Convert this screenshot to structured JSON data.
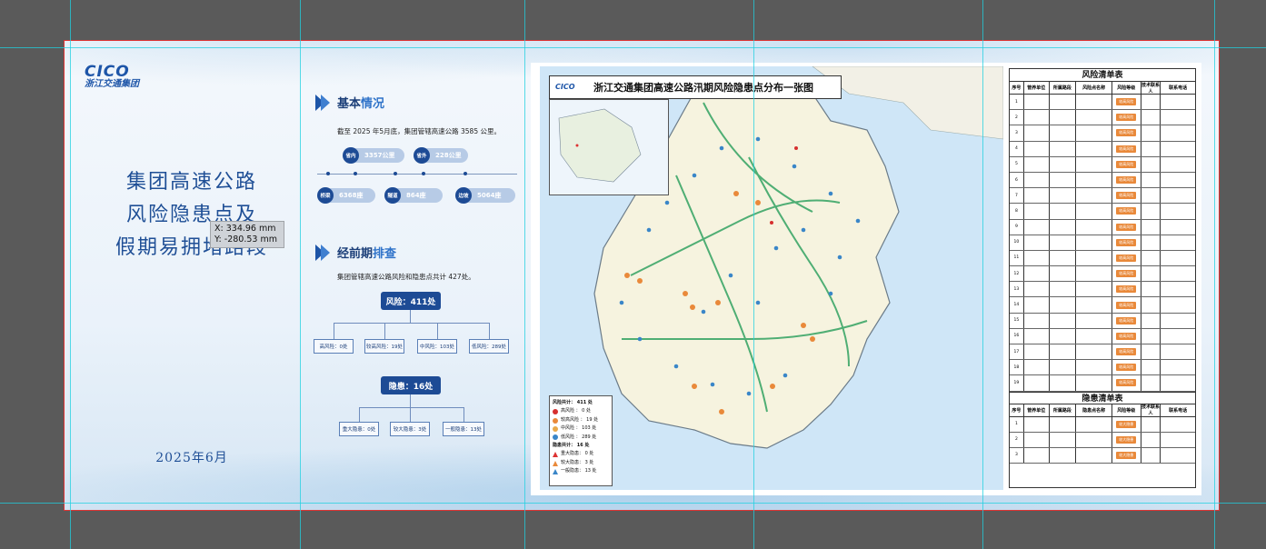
{
  "cover": {
    "logo_en": "CICO",
    "logo_cn": "浙江交通集团",
    "title_line1": "集团高速公路",
    "title_line2": "风险隐患点及",
    "title_line3": "假期易拥堵路段",
    "date": "2025年6月"
  },
  "coord_tooltip": {
    "x": "X: 334.96 mm",
    "y": "Y: -280.53 mm"
  },
  "section1": {
    "head_a": "基本",
    "head_b": "情况",
    "paragraph": "截至 2025 年5月底，集团管辖高速公路 3585 公里。",
    "stats": [
      {
        "icon": "省内",
        "value": "3357公里"
      },
      {
        "icon": "省外",
        "value": "228公里"
      },
      {
        "icon": "桥梁",
        "value": "6368座"
      },
      {
        "icon": "隧道",
        "value": "864座"
      },
      {
        "icon": "边坡",
        "value": "5064座"
      }
    ]
  },
  "section2": {
    "head_a": "经前期",
    "head_b": "排查",
    "paragraph": "集团管辖高速公路风险和隐患点共计 427处。",
    "risk_total": "风险：411处",
    "risk_items": [
      "高风险：0处",
      "较高风险：19处",
      "中风险：103处",
      "低风险：289处"
    ],
    "hazard_total": "隐患：16处",
    "hazard_items": [
      "重大隐患：0处",
      "较大隐患：3处",
      "一般隐患：13处"
    ]
  },
  "map": {
    "logo": "CICO",
    "title": "浙江交通集团高速公路汛期风险隐患点分布一张图",
    "legend": {
      "risk_title": "风险共计： 411 处",
      "risk_rows": [
        "高风险  ：  0  处",
        "较高风险 ： 19  处",
        "中风险  ： 103 处",
        "低风险  ： 289 处"
      ],
      "hazard_title": "隐患共计： 16 处",
      "hazard_rows": [
        "重大隐患： 0  处",
        "较大隐患： 3  处",
        "一般隐患： 13 处"
      ]
    },
    "colors": {
      "high": "#d62f2f",
      "med_high": "#e9893a",
      "med": "#e9a94a",
      "low": "#3a86c8",
      "hazard": "#d62f2f"
    }
  },
  "risk_table": {
    "title": "风险清单表",
    "headers": [
      "序号",
      "管养单位",
      "所属路段",
      "风险点名称",
      "风险等级",
      "技术联系人",
      "联系电话"
    ],
    "rows": [
      {
        "no": "1",
        "level": "较高风险"
      },
      {
        "no": "2",
        "level": "较高风险"
      },
      {
        "no": "3",
        "level": "较高风险"
      },
      {
        "no": "4",
        "level": "较高风险"
      },
      {
        "no": "5",
        "level": "较高风险"
      },
      {
        "no": "6",
        "level": "较高风险"
      },
      {
        "no": "7",
        "level": "较高风险"
      },
      {
        "no": "8",
        "level": "较高风险"
      },
      {
        "no": "9",
        "level": "较高风险"
      },
      {
        "no": "10",
        "level": "较高风险"
      },
      {
        "no": "11",
        "level": "较高风险"
      },
      {
        "no": "12",
        "level": "较高风险"
      },
      {
        "no": "13",
        "level": "较高风险"
      },
      {
        "no": "14",
        "level": "较高风险"
      },
      {
        "no": "15",
        "level": "较高风险"
      },
      {
        "no": "16",
        "level": "较高风险"
      },
      {
        "no": "17",
        "level": "较高风险"
      },
      {
        "no": "18",
        "level": "较高风险"
      },
      {
        "no": "19",
        "level": "较高风险"
      }
    ]
  },
  "hazard_table": {
    "title": "隐患清单表",
    "headers": [
      "序号",
      "管养单位",
      "所属路段",
      "隐患点名称",
      "风险等级",
      "技术联系人",
      "联系电话"
    ],
    "rows": [
      {
        "no": "1",
        "level": "较大隐患"
      },
      {
        "no": "2",
        "level": "较大隐患"
      },
      {
        "no": "3",
        "level": "较大隐患"
      }
    ]
  }
}
